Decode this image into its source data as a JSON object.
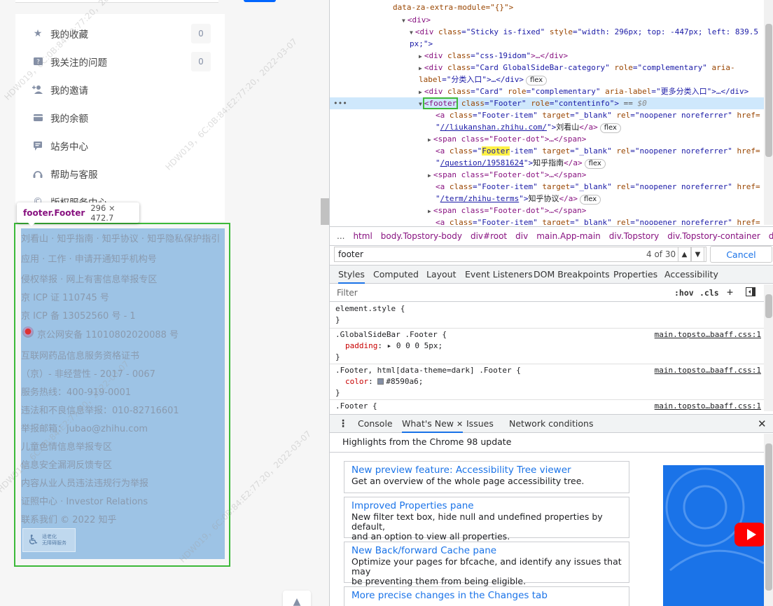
{
  "page": {
    "menu": [
      {
        "label": "我的收藏",
        "count": "0",
        "icon": "star-icon"
      },
      {
        "label": "我关注的问题",
        "count": "0",
        "icon": "question-icon"
      },
      {
        "label": "我的邀请",
        "count": null,
        "icon": "add-user-icon"
      },
      {
        "label": "我的余额",
        "count": null,
        "icon": "wallet-icon"
      },
      {
        "label": "站务中心",
        "count": null,
        "icon": "flag-icon"
      },
      {
        "label": "帮助与客服",
        "count": null,
        "icon": "headset-icon"
      },
      {
        "label": "版权服务中心",
        "count": null,
        "icon": "copyright-icon"
      }
    ],
    "tooltip": {
      "tag": "footer.Footer",
      "size": "296 × 472.7"
    },
    "footer_lines": [
      "刘看山 · 知乎指南 · 知乎协议 · 知乎隐私保护指引",
      "应用 · 工作 · 申请开通知乎机构号",
      "侵权举报 · 网上有害信息举报专区",
      "京 ICP 证 110745 号",
      "京 ICP 备 13052560 号 - 1",
      "京公网安备 11010802020088 号",
      "互联网药品信息服务资格证书",
      "（京）- 非经营性 - 2017 - 0067",
      "服务热线：400-919-0001",
      "违法和不良信息举报：010-82716601",
      "举报邮箱：jubao@zhihu.com",
      "儿童色情信息举报专区",
      "信息安全漏洞反馈专区",
      "内容从业人员违法违规行为举报",
      "证照中心 · Investor Relations",
      "联系我们 © 2022 知乎"
    ],
    "a11y_badge": {
      "line1": "适老化",
      "line2": "无障碍服务"
    },
    "watermark": "HDW019，6C:0B:84:E2:77:20，2022-03-07"
  },
  "devtools": {
    "elements": {
      "l0": "data-za-extra-module=\"{}\">",
      "l1": "<div>",
      "l2a": "<div ",
      "l2b": "class",
      "l2c": "=\"Sticky is-fixed\" ",
      "l2d": "style",
      "l2e": "=\"width: 296px; top: -447px; left: 839.5",
      "l3": "px;\">",
      "l4a": "<div ",
      "l4b": "class",
      "l4c": "=\"css-19idom\"",
      "l4d": ">…</div>",
      "l5a": "<div ",
      "l5b": "class",
      "l5c": "=\"Card GlobalSideBar-category\" ",
      "l5d": "role",
      "l5e": "=\"complementary\" ",
      "l5f": "aria-",
      "l6a": "label",
      "l6b": "=\"分类入口\">…</div>",
      "l6pill": "flex",
      "l7a": "<div ",
      "l7b": "class",
      "l7c": "=\"Card\" ",
      "l7d": "role",
      "l7e": "=\"complementary\" ",
      "l7f": "aria-label",
      "l7g": "=\"更多分类入口\">…</div>",
      "l8a": "<",
      "l8tag": "footer",
      "l8b": " class",
      "l8c": "=\"Footer\" ",
      "l8d": "role",
      "l8e": "=\"contentinfo\">",
      "l8f": " == ",
      "l8g": "$0",
      "l9a": "<a ",
      "l9b": "class",
      "l9c": "=\"Footer-item\" ",
      "l9d": "target",
      "l9e": "=\"_blank\" ",
      "l9f": "rel",
      "l9g": "=\"noopener noreferrer\" ",
      "l9h": "href=",
      "l10a": "\"",
      "l10link": "//liukanshan.zhihu.com/",
      "l10b": "\">",
      "l10txt": "刘看山",
      "l10c": "</a>",
      "l10pill": "flex",
      "l11": "<span class=\"Footer-dot\">…</span>",
      "l12a": "<a ",
      "l12b": "class",
      "l12c": "=\"",
      "l12hl": "Footer",
      "l12d": "-item\" ",
      "l12e": "target",
      "l12f": "=\"_blank\" ",
      "l12g": "rel",
      "l12h": "=\"noopener noreferrer\" ",
      "l12i": "href=",
      "l13a": "\"",
      "l13link": "/question/19581624",
      "l13b": "\">",
      "l13txt": "知乎指南",
      "l13c": "</a>",
      "l13pill": "flex",
      "l14": "<span class=\"Footer-dot\">…</span>",
      "l15a": "<a ",
      "l15b": "class",
      "l15c": "=\"Footer-item\" ",
      "l15d": "target",
      "l15e": "=\"_blank\" ",
      "l15f": "rel",
      "l15g": "=\"noopener noreferrer\" ",
      "l15h": "href=",
      "l16a": "\"",
      "l16link": "/term/zhihu-terms",
      "l16b": "\">",
      "l16txt": "知乎协议",
      "l16c": "</a>",
      "l16pill": "flex",
      "l17": "<span class=\"Footer-dot\">…</span>",
      "l18a": "<a ",
      "l18b": "class",
      "l18c": "=\"Footer-item\" ",
      "l18d": "target",
      "l18e": "=\"_blank\" ",
      "l18f": "rel",
      "l18g": "=\"noopener noreferrer\" ",
      "l18h": "href="
    },
    "breadcrumb": [
      "...",
      "html",
      "body.Topstory-body",
      "div#root",
      "div",
      "main.App-main",
      "div.Topstory",
      "div.Topstory-container",
      "div"
    ],
    "find": {
      "query": "footer",
      "count": "4 of 30",
      "cancel": "Cancel"
    },
    "style_tabs": [
      "Styles",
      "Computed",
      "Layout",
      "Event Listeners",
      "DOM Breakpoints",
      "Properties",
      "Accessibility"
    ],
    "filter": {
      "placeholder": "Filter",
      "hov": ":hov",
      "cls": ".cls",
      "plus": "+"
    },
    "rules": {
      "r1sel": "element.style {",
      "r1end": "}",
      "r2sel": ".GlobalSideBar .Footer {",
      "r2src": "main.topsto…baaff.css:1",
      "r2prop": "padding",
      "r2val": "0 0 0 5px;",
      "r2end": "}",
      "r3sel": ".Footer, html[data-theme=dark] .Footer {",
      "r3src": "main.topsto…baaff.css:1",
      "r3prop": "color",
      "r3val": "#8590a6;",
      "r3end": "}",
      "r4sel": ".Footer {",
      "r4src": "main.topsto…baaff.css:1"
    },
    "drawer_tabs": {
      "console": "Console",
      "whatsnew": "What's New",
      "issues": "Issues",
      "network": "Network conditions"
    },
    "whatsnew": {
      "heading": "Highlights from the Chrome 98 update",
      "cards": [
        {
          "title": "New preview feature: Accessibility Tree viewer",
          "desc": [
            "Get an overview of the whole page accessibility tree."
          ]
        },
        {
          "title": "Improved Properties pane",
          "desc": [
            "New filter text box, hide null and undefined properties by default,",
            "and an option to view all properties."
          ]
        },
        {
          "title": "New Back/forward Cache pane",
          "desc": [
            "Optimize your pages for bfcache, and identify any issues that may",
            "be preventing them from being eligible."
          ]
        },
        {
          "title": "More precise changes in the Changes tab",
          "desc": []
        }
      ]
    },
    "colors": {
      "accent": "#1a73e8",
      "highlight": "#6fa8dc",
      "outline": "#3cb939",
      "footer_text": "#8590a6"
    }
  }
}
